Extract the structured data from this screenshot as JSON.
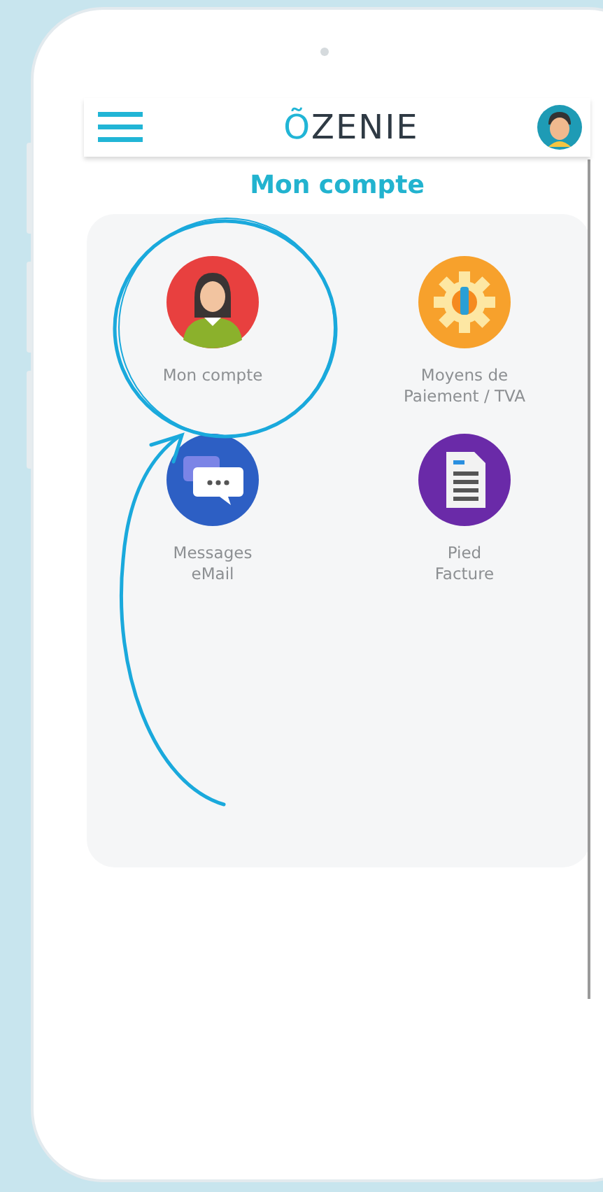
{
  "header": {
    "logo_mark": "Õ",
    "logo_text": "ZENIE"
  },
  "title": "Mon compte",
  "tiles": [
    {
      "kind": "person",
      "label": "Mon compte"
    },
    {
      "kind": "gear",
      "label": "Moyens de\nPaiement / TVA"
    },
    {
      "kind": "chat",
      "label": "Messages\neMail"
    },
    {
      "kind": "document",
      "label": "Pied\nFacture"
    }
  ]
}
